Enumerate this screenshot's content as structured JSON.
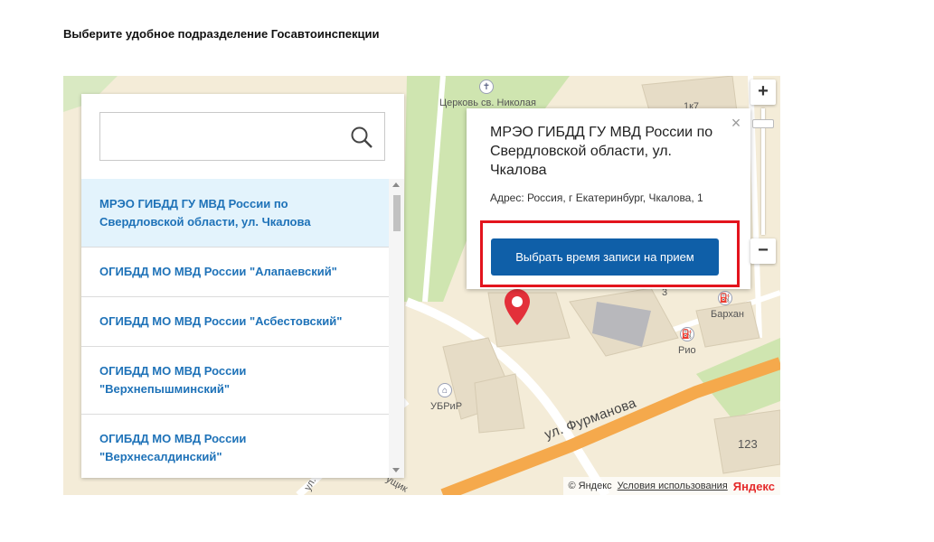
{
  "heading": "Выберите удобное подразделение Госавтоинспекции",
  "search": {
    "placeholder": "",
    "value": ""
  },
  "units": [
    {
      "label": "МРЭО ГИБДД ГУ МВД России по Свердловской области, ул. Чкалова",
      "selected": true
    },
    {
      "label": "ОГИБДД МО МВД России \"Алапаевский\"",
      "selected": false
    },
    {
      "label": "ОГИБДД МО МВД России \"Асбестовский\"",
      "selected": false
    },
    {
      "label": "ОГИБДД МО МВД России \"Верхнепышминский\"",
      "selected": false
    },
    {
      "label": "ОГИБДД МО МВД России \"Верхнесалдинский\"",
      "selected": false
    }
  ],
  "balloon": {
    "title": "МРЭО ГИБДД ГУ МВД России по Свердловской области, ул. Чкалова",
    "address": "Адрес: Россия, г Екатеринбург, Чкалова, 1",
    "button_label": "Выбрать время записи на прием",
    "close_glyph": "×"
  },
  "map": {
    "zoom_in": "+",
    "zoom_out": "−",
    "labels": {
      "church": "Церковь св. Николая",
      "barkhan": "Бархан",
      "rio": "Рио",
      "ubrir": "УБРиР",
      "street_furmanova": "ул. Фурманова",
      "house_123": "123",
      "house_3": "3",
      "house_1k7": "1к7",
      "street_partial": "ул.",
      "street_partial_2": "ущик"
    },
    "copyright": "© Яндекс",
    "terms_link": "Условия использования",
    "logo": "Яндекс"
  },
  "colors": {
    "accent": "#1e72b8",
    "button": "#0f5fa8",
    "highlight": "#e3141d",
    "selected_row": "#e3f3fc",
    "marker": "#e3303a",
    "road": "#f5a94c",
    "park": "#cfe5b0"
  },
  "icons": {
    "search": "search-icon",
    "close": "close-icon",
    "marker": "map-marker-icon",
    "church": "church-icon",
    "fuel": "fuel-station-icon",
    "bank": "bank-icon"
  }
}
